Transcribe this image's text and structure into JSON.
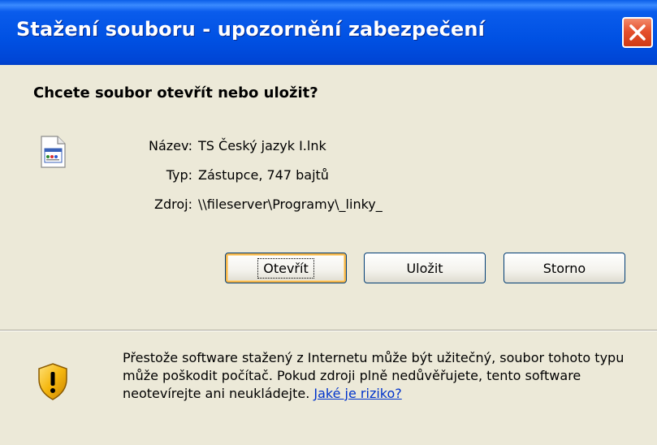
{
  "window": {
    "title": "Stažení souboru - upozornění zabezpečení"
  },
  "dialog": {
    "question": "Chcete soubor otevřít nebo uložit?",
    "file": {
      "name_label": "Název:",
      "name_value": "TS Český jazyk I.lnk",
      "type_label": "Typ:",
      "type_value": "Zástupce, 747 bajtů",
      "source_label": "Zdroj:",
      "source_value": "\\\\fileserver\\Programy\\_linky_"
    },
    "buttons": {
      "open": "Otevřít",
      "save": "Uložit",
      "cancel": "Storno"
    },
    "warning": {
      "text": "Přestože software stažený z Internetu může být užitečný, soubor tohoto typu může poškodit počítač. Pokud zdroji plně nedůvěřujete, tento software neotevírejte ani neukládejte.",
      "link": "Jaké je riziko?"
    }
  },
  "colors": {
    "titlebar": "#0051e3",
    "dialog_bg": "#ece9d8",
    "close": "#e5512e",
    "link": "#0033cc",
    "default_button_highlight": "#f4b54a"
  },
  "icons": [
    "close-icon",
    "shortcut-file-icon",
    "security-shield-icon"
  ]
}
